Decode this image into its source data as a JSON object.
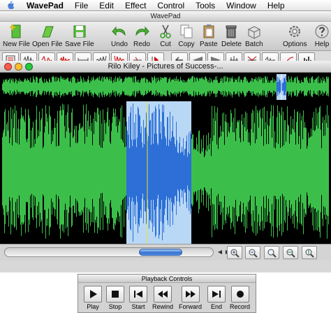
{
  "menubar": {
    "app_name": "WavePad",
    "items": [
      "File",
      "Edit",
      "Effect",
      "Control",
      "Tools",
      "Window",
      "Help"
    ]
  },
  "app_window": {
    "title": "WavePad"
  },
  "toolbar": {
    "buttons": [
      {
        "label": "New File",
        "icon": "new-file-icon"
      },
      {
        "label": "Open File",
        "icon": "open-file-icon"
      },
      {
        "label": "Save File",
        "icon": "save-file-icon"
      },
      {
        "label": "Undo",
        "icon": "undo-icon"
      },
      {
        "label": "Redo",
        "icon": "redo-icon"
      },
      {
        "label": "Cut",
        "icon": "cut-icon"
      },
      {
        "label": "Copy",
        "icon": "copy-icon"
      },
      {
        "label": "Paste",
        "icon": "paste-icon"
      },
      {
        "label": "Delete",
        "icon": "delete-icon"
      },
      {
        "label": "Batch",
        "icon": "batch-icon"
      },
      {
        "label": "Options",
        "icon": "options-icon"
      },
      {
        "label": "Help",
        "icon": "help-icon"
      }
    ]
  },
  "document": {
    "title": "Rilo Kiley - Pictures of Success-..."
  },
  "colors": {
    "waveform": "#3bbf4a",
    "selection": "#b9d8f6",
    "selection_wave": "#2d6fd6",
    "background": "#000000"
  },
  "playback": {
    "title": "Playback Controls",
    "buttons": [
      {
        "label": "Play",
        "icon": "play-icon"
      },
      {
        "label": "Stop",
        "icon": "stop-icon"
      },
      {
        "label": "Start",
        "icon": "skip-start-icon"
      },
      {
        "label": "Rewind",
        "icon": "rewind-icon"
      },
      {
        "label": "Forward",
        "icon": "fast-forward-icon"
      },
      {
        "label": "End",
        "icon": "skip-end-icon"
      },
      {
        "label": "Record",
        "icon": "record-icon"
      }
    ]
  }
}
